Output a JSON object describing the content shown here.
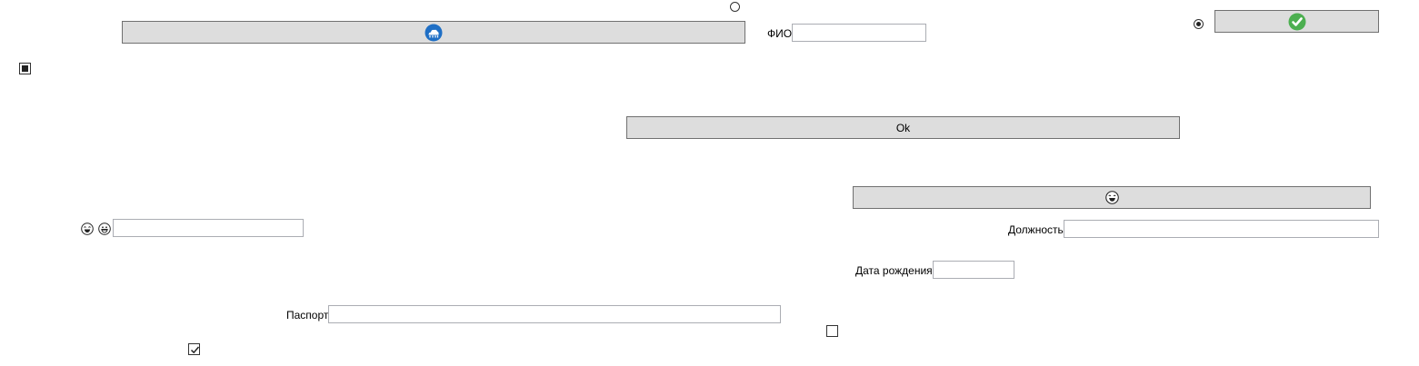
{
  "fields": {
    "fio_label": "ФИО",
    "fio_value": "",
    "position_label": "Должность",
    "position_value": "",
    "birthdate_label": "Дата рождения",
    "birthdate_value": "",
    "passport_label": "Паспорт",
    "passport_value": "",
    "emoji_field_value": ""
  },
  "buttons": {
    "ok_label": "Ok",
    "cloud_icon": "cloud-icon",
    "check_icon": "green-check-icon",
    "emoji_icon": "laughing-face-icon"
  },
  "controls": {
    "radio_top_checked": false,
    "radio_right_checked": true,
    "checkbox_left_state": "indeterminate",
    "checkbox_middle_checked": false,
    "checkbox_bottom_checked": true
  },
  "emoji_labels": [
    "laughing-face-icon",
    "grinning-face-icon"
  ],
  "colors": {
    "button_bg": "#dddddd",
    "button_border": "#707070",
    "input_border": "#abadb3",
    "cloud_blue": "#1f6fc5",
    "check_green": "#4caf50"
  }
}
